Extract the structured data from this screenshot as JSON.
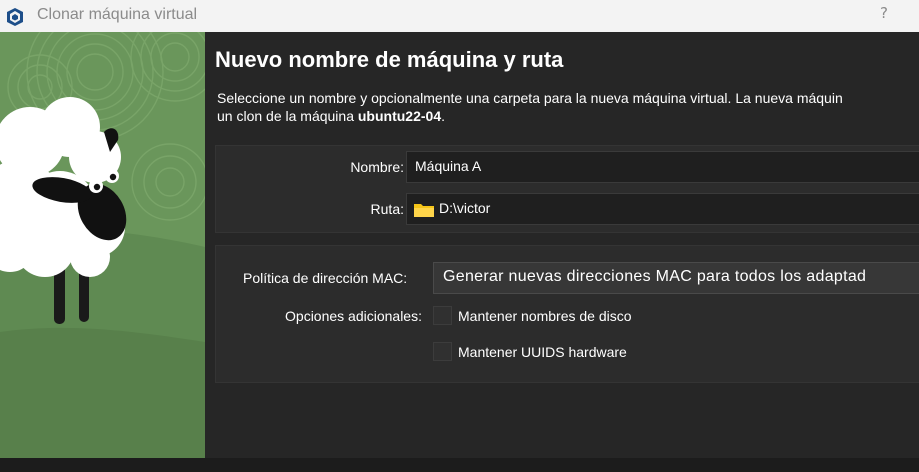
{
  "window": {
    "title": "Clonar máquina virtual",
    "help": "?"
  },
  "page": {
    "heading": "Nuevo nombre de máquina y ruta",
    "description_line1": "Seleccione un nombre y opcionalmente una carpeta para la nueva máquina virtual. La nueva máquin",
    "description_prefix": "un clon de la máquina ",
    "description_vm": "ubuntu22-04",
    "description_suffix": "."
  },
  "form": {
    "name_label": "Nombre:",
    "name_value": "Máquina A",
    "path_label": "Ruta:",
    "path_value": "D:\\victor",
    "mac_label": "Política de dirección MAC:",
    "mac_value": "Generar nuevas direcciones MAC para todos los adaptad",
    "extra_label": "Opciones adicionales:",
    "keep_disk_names": "Mantener nombres de disco",
    "keep_uuids": "Mantener UUIDS hardware"
  },
  "colors": {
    "sidebar_green": "#69955a",
    "folder_yellow": "#f5c518",
    "background": "#262626"
  },
  "icons": {
    "app": "virtualbox-icon",
    "folder": "folder-icon"
  }
}
